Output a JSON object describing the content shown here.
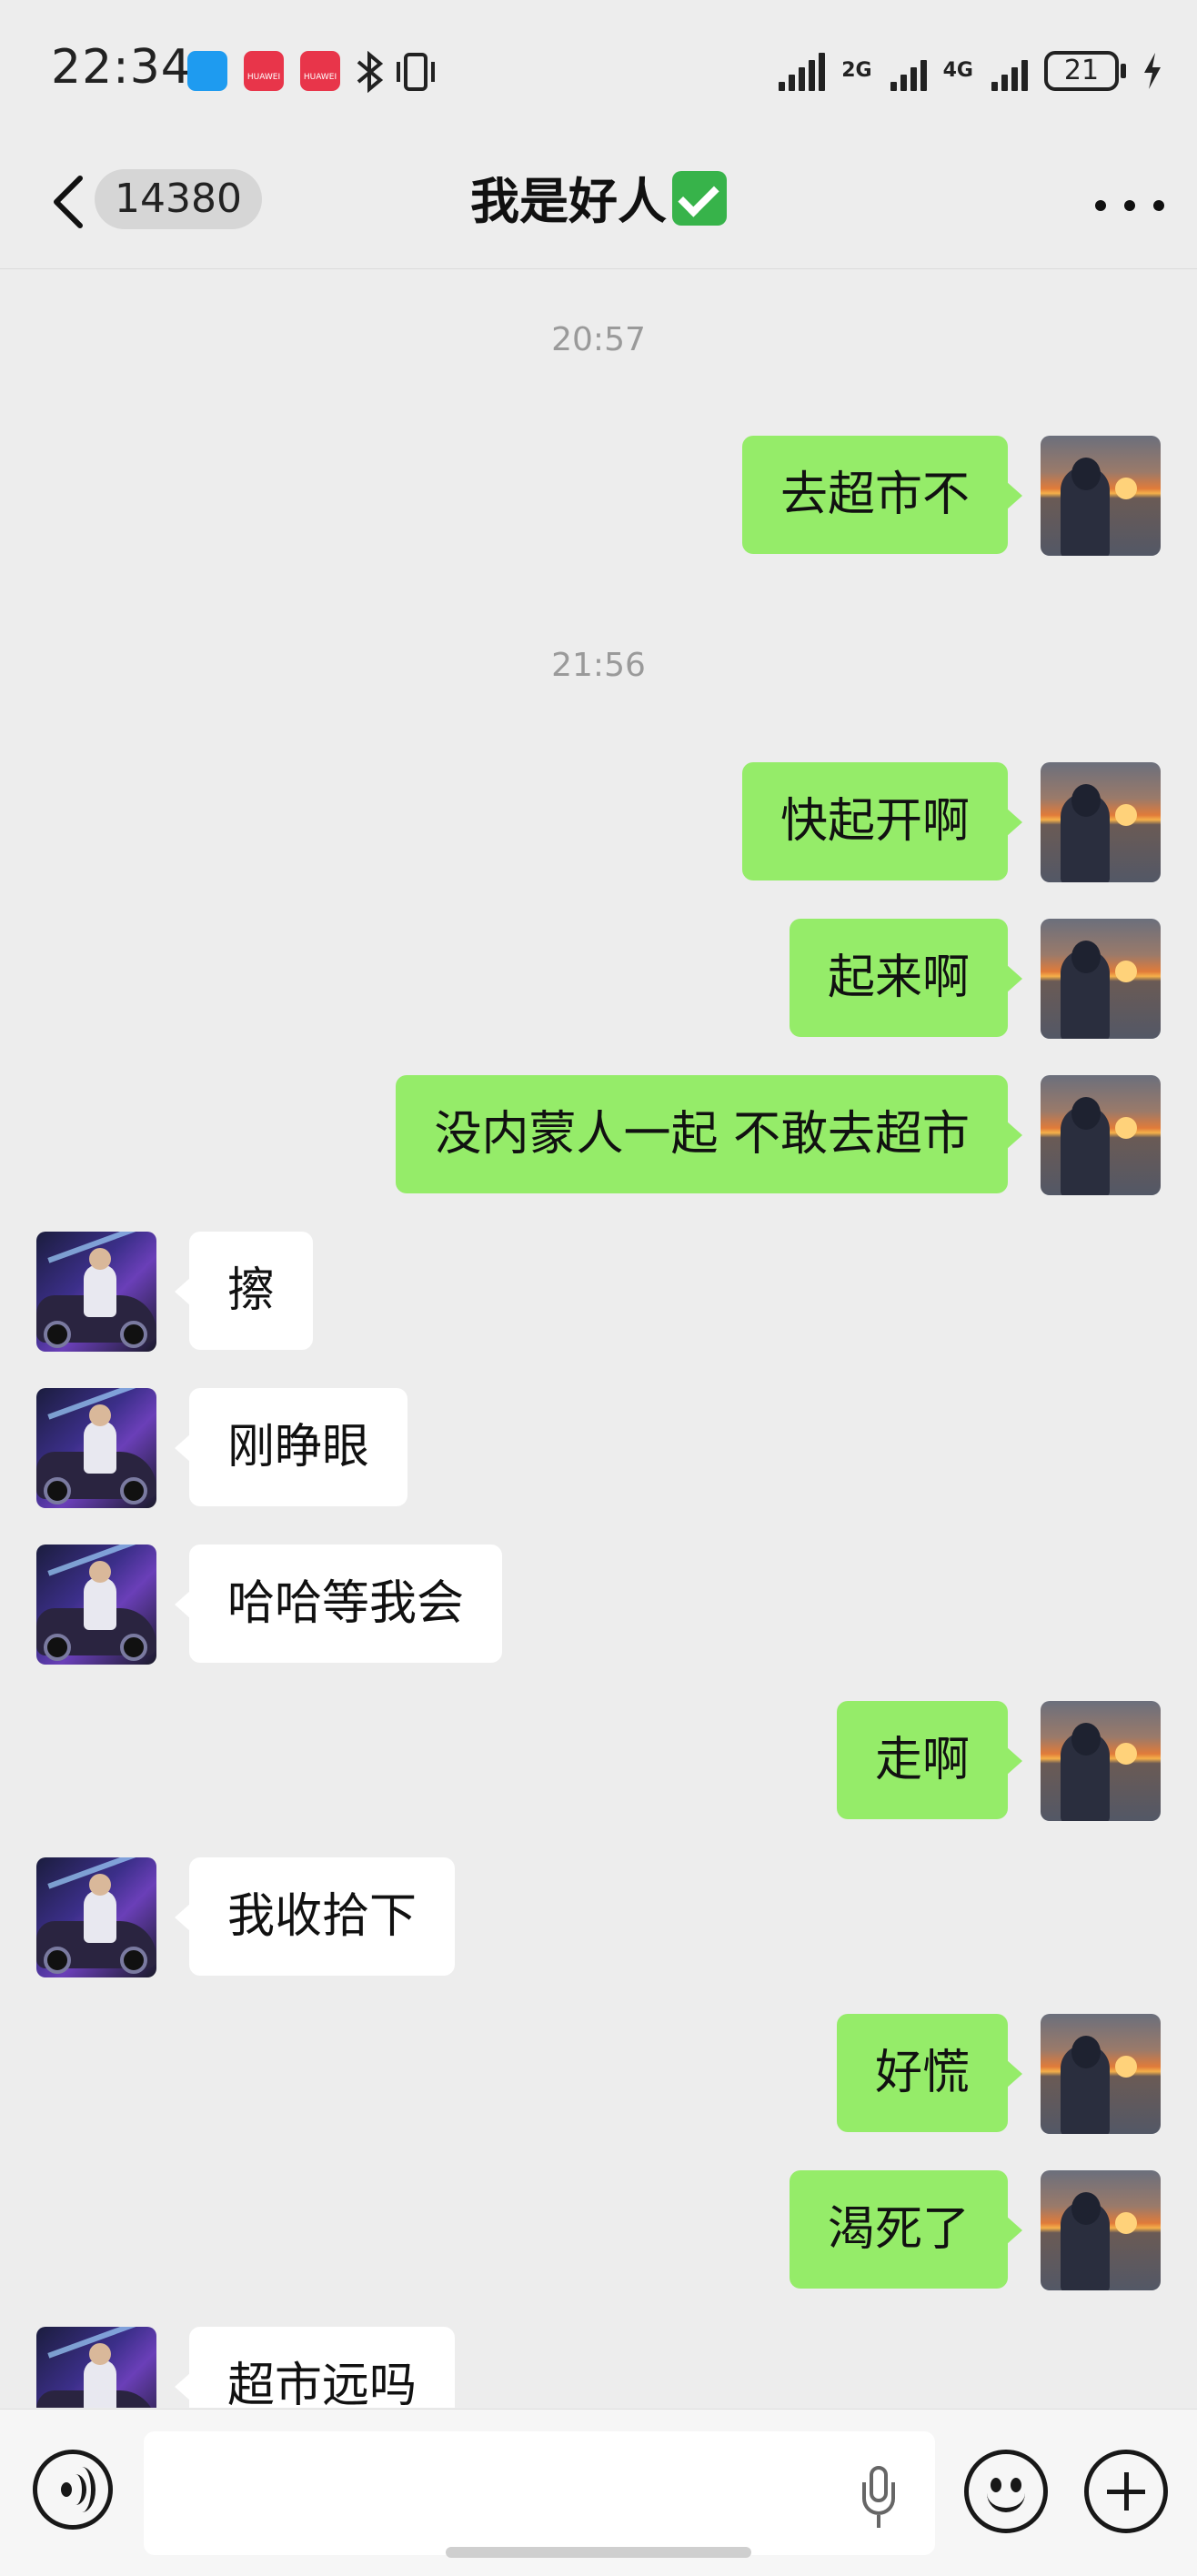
{
  "status_bar": {
    "time": "22:34",
    "network_1": "2G",
    "network_2": "4G",
    "battery": "21"
  },
  "nav": {
    "unread_count": "14380",
    "title": "我是好人",
    "title_emoji_icon": "check-mark-emoji-icon"
  },
  "messages": [
    {
      "type": "timestamp",
      "text": "20:57"
    },
    {
      "type": "sent",
      "text": "去超市不"
    },
    {
      "type": "timestamp",
      "text": "21:56"
    },
    {
      "type": "sent",
      "text": "快起开啊"
    },
    {
      "type": "sent",
      "text": "起来啊"
    },
    {
      "type": "sent",
      "text": "没内蒙人一起 不敢去超市"
    },
    {
      "type": "received",
      "text": "擦"
    },
    {
      "type": "received",
      "text": "刚睁眼"
    },
    {
      "type": "received",
      "text": "哈哈等我会"
    },
    {
      "type": "sent",
      "text": "走啊"
    },
    {
      "type": "received",
      "text": "我收拾下"
    },
    {
      "type": "sent",
      "text": "好慌"
    },
    {
      "type": "sent",
      "text": "渴死了"
    },
    {
      "type": "received",
      "text": "超市远吗"
    }
  ],
  "input_bar": {
    "text_value": "",
    "icons": [
      "voice-icon",
      "microphone-icon",
      "emoji-icon",
      "plus-icon"
    ]
  },
  "colors": {
    "background": "#ededed",
    "sent_bubble": "#95ec69",
    "received_bubble": "#ffffff",
    "timestamp": "#9a9a9a"
  }
}
